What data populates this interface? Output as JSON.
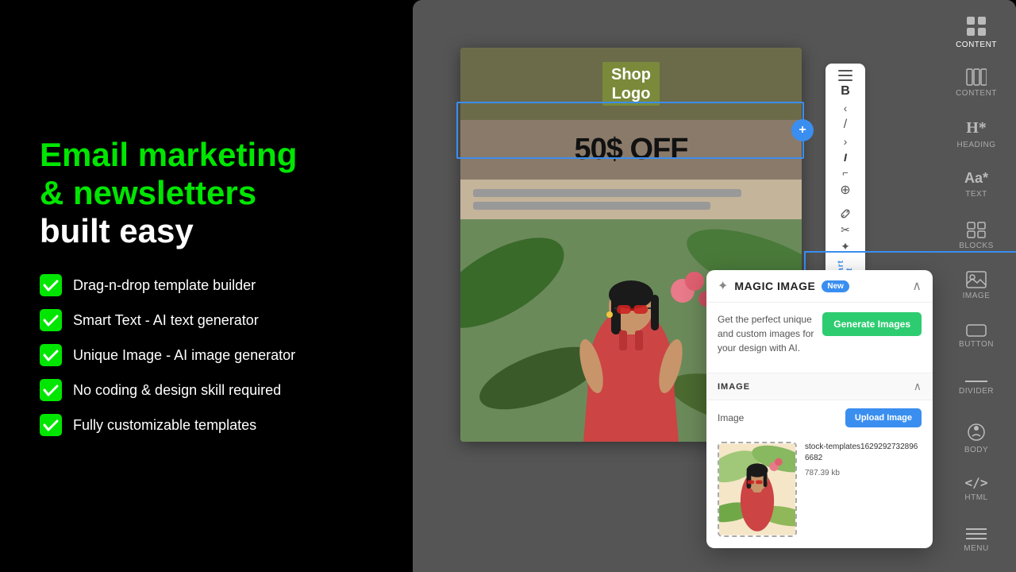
{
  "left": {
    "headline_green": "Email marketing\n& newsletters",
    "headline_white": "built easy",
    "features": [
      "Drag-n-drop template builder",
      "Smart Text - AI text generator",
      "Unique Image - AI image generator",
      "No coding & design skill required",
      "Fully customizable templates"
    ]
  },
  "editor": {
    "shop_logo_line1": "Shop",
    "shop_logo_line2": "Logo",
    "heading": "50$ OFF",
    "text_line1_width": "85%",
    "text_line2_width": "65%"
  },
  "right_toolbar": {
    "items": [
      {
        "id": "content",
        "label": "Content",
        "icon": "⊞"
      },
      {
        "id": "columns",
        "label": "Columns",
        "icon": "⊟"
      },
      {
        "id": "heading",
        "label": "Heading",
        "icon": "H"
      },
      {
        "id": "text",
        "label": "Text",
        "icon": "Aa"
      },
      {
        "id": "blocks",
        "label": "Blocks",
        "icon": "⊞"
      },
      {
        "id": "image",
        "label": "Image",
        "icon": "🖼"
      },
      {
        "id": "button",
        "label": "Button",
        "icon": "◻"
      },
      {
        "id": "divider",
        "label": "Divider",
        "icon": "—"
      },
      {
        "id": "body",
        "label": "Body",
        "icon": "○"
      },
      {
        "id": "html",
        "label": "HTML",
        "icon": "<>"
      },
      {
        "id": "menu",
        "label": "Menu",
        "icon": "≡"
      }
    ]
  },
  "magic_panel": {
    "title": "MAGIC IMAGE",
    "badge": "New",
    "description": "Get the perfect unique and custom images for your design with AI.",
    "generate_button": "Generate Images",
    "image_section_label": "IMAGE",
    "image_label": "Image",
    "upload_button": "Upload Image",
    "filename": "stock-templates16292927328966682",
    "filesize": "787.39 kb"
  },
  "left_toolbar": {
    "icons": [
      "≡",
      "B",
      "‹",
      "/",
      "›",
      "I",
      "⌐",
      "⊕",
      "🔗",
      "✂",
      "✦",
      "▶",
      "‹",
      "▲",
      "‹",
      "✕",
      "✕",
      "⊙",
      "⚡"
    ]
  }
}
